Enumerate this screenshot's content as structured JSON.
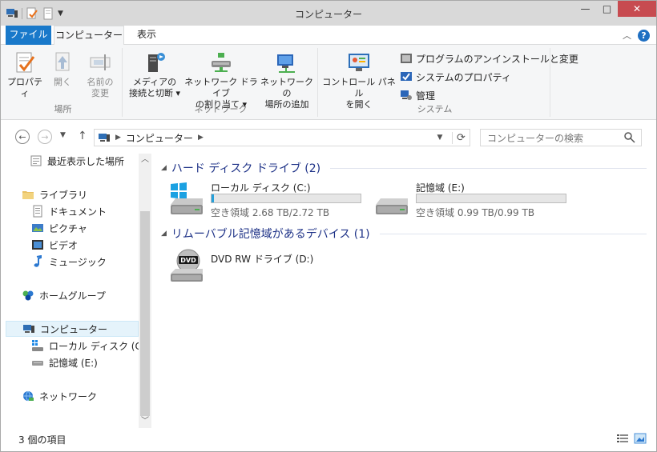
{
  "window": {
    "title": "コンピューター"
  },
  "tabs": {
    "file": "ファイル",
    "computer": "コンピューター",
    "view": "表示"
  },
  "ribbon": {
    "location": {
      "label": "場所",
      "properties": "プロパティ",
      "open": "開く",
      "rename_line1": "名前の",
      "rename_line2": "変更"
    },
    "network": {
      "label": "ネットワーク",
      "media_line1": "メディアの",
      "media_line2": "接続と切断 ▾",
      "map_line1": "ネットワーク ドライブ",
      "map_line2": "の割り当て ▾",
      "add_line1": "ネットワークの",
      "add_line2": "場所の追加"
    },
    "system": {
      "label": "システム",
      "control_line1": "コントロール パネル",
      "control_line2": "を開く",
      "uninstall": "プログラムのアンインストールと変更",
      "sys_props": "システムのプロパティ",
      "manage": "管理"
    }
  },
  "address": {
    "path": "コンピューター",
    "search_placeholder": "コンピューターの検索"
  },
  "sidebar": {
    "recent": "最近表示した場所",
    "libraries": "ライブラリ",
    "documents": "ドキュメント",
    "pictures": "ピクチャ",
    "videos": "ビデオ",
    "music": "ミュージック",
    "homegroup": "ホームグループ",
    "computer": "コンピューター",
    "local_disk": "ローカル ディスク (C:)",
    "storage": "記憶域 (E:)",
    "network": "ネットワーク"
  },
  "content": {
    "hdd_header": "ハード ディスク ドライブ (2)",
    "removable_header": "リムーバブル記憶域があるデバイス (1)",
    "drives": [
      {
        "name": "ローカル ディスク (C:)",
        "free": "空き領域 2.68 TB/2.72 TB",
        "used_fraction": 0.015
      },
      {
        "name": "記憶域 (E:)",
        "free": "空き領域 0.99 TB/0.99 TB",
        "used_fraction": 0.0
      }
    ],
    "dvd": {
      "name": "DVD RW ドライブ (D:)",
      "badge": "DVD"
    }
  },
  "status": {
    "count": "3 個の項目"
  },
  "colors": {
    "accent": "#1979ca",
    "close": "#c74b50",
    "section": "#1e3287",
    "bar_fill": "#26a0da"
  }
}
